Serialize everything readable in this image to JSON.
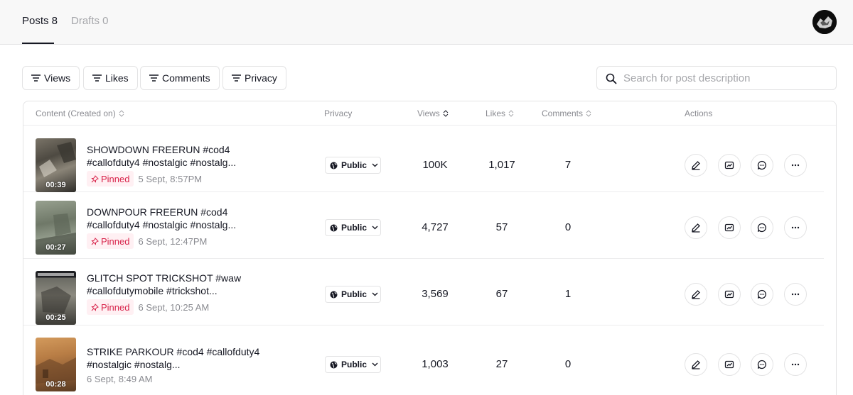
{
  "tabs": [
    {
      "label": "Posts 8",
      "active": true
    },
    {
      "label": "Drafts 0",
      "active": false
    }
  ],
  "filters": [
    {
      "label": "Views",
      "icon": "filter-icon"
    },
    {
      "label": "Likes",
      "icon": "filter-icon"
    },
    {
      "label": "Comments",
      "icon": "filter-icon"
    },
    {
      "label": "Privacy",
      "icon": "filter-icon"
    }
  ],
  "search": {
    "placeholder": "Search for post description",
    "value": ""
  },
  "table": {
    "headers": {
      "content": "Content (Created on)",
      "privacy": "Privacy",
      "views": "Views",
      "likes": "Likes",
      "comments": "Comments",
      "actions": "Actions"
    },
    "rows": [
      {
        "title": "SHOWDOWN FREERUN #cod4 #callofduty4 #nostalgic #nostalg...",
        "duration": "00:39",
        "pinned": "Pinned",
        "date": "5 Sept, 8:57PM",
        "privacy": "Public",
        "views": "100K",
        "likes": "1,017",
        "comments": "7"
      },
      {
        "title": "DOWNPOUR FREERUN #cod4 #callofduty4 #nostalgic #nostalg...",
        "duration": "00:27",
        "pinned": "Pinned",
        "date": "6 Sept, 12:47PM",
        "privacy": "Public",
        "views": "4,727",
        "likes": "57",
        "comments": "0"
      },
      {
        "title": "GLITCH SPOT TRICKSHOT #waw #callofdutymobile #trickshot...",
        "duration": "00:25",
        "pinned": "Pinned",
        "date": "6 Sept, 10:25 AM",
        "privacy": "Public",
        "views": "3,569",
        "likes": "67",
        "comments": "1"
      },
      {
        "title": "STRIKE PARKOUR #cod4 #callofduty4 #nostalgic #nostalg...",
        "duration": "00:28",
        "pinned": "",
        "date": "6 Sept, 8:49 AM",
        "privacy": "Public",
        "views": "1,003",
        "likes": "27",
        "comments": "0"
      }
    ]
  },
  "colors": {
    "pinned": "#d8234a",
    "pinned_bg": "#fff0f3",
    "text": "#161823",
    "muted": "#8a8b91",
    "border": "#e3e3e4"
  }
}
